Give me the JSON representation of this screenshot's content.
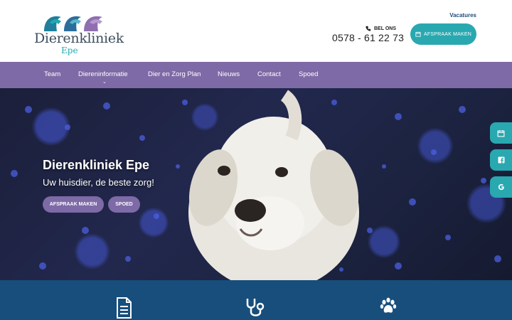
{
  "header": {
    "logo_title": "Dierenkliniek",
    "logo_sub": "Epe",
    "vacatures": "Vacatures",
    "bel_ons": "BEL ONS",
    "phone": "0578 - 61 22 73",
    "afspraak_button": "AFSPRAAK MAKEN"
  },
  "nav": {
    "items": [
      "Team",
      "Diereninformatie",
      "Dier en Zorg Plan",
      "Nieuws",
      "Contact",
      "Spoed"
    ]
  },
  "hero": {
    "title": "Dierenkliniek Epe",
    "subtitle": "Uw huisdier, de beste zorg!",
    "btn_afspraak": "AFSPRAAK MAKEN",
    "btn_spoed": "SPOED"
  },
  "side_tabs": [
    "calendar-icon",
    "facebook-icon",
    "google-icon"
  ],
  "band_icons": [
    "document-icon",
    "stethoscope-icon",
    "paw-icon"
  ],
  "colors": {
    "purple": "#7e6aa6",
    "teal": "#29a8b0",
    "navy": "#174e7c"
  }
}
